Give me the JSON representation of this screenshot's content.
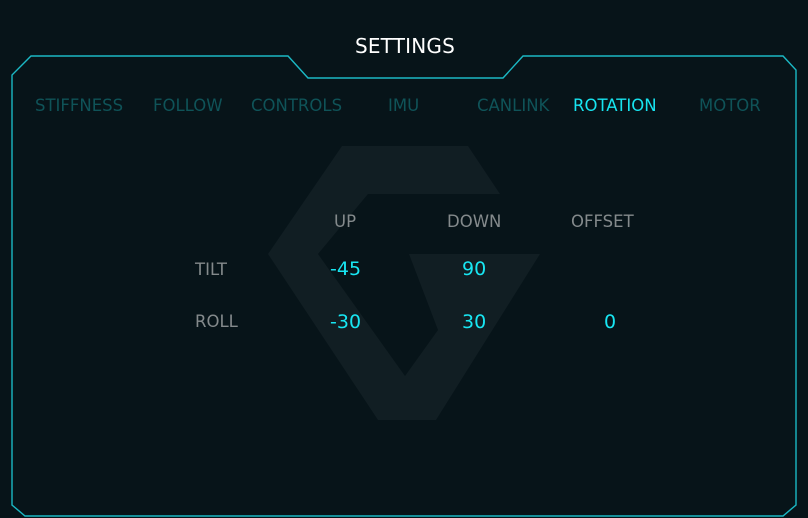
{
  "header": {
    "title": "SETTINGS"
  },
  "tabs": [
    {
      "label": "STIFFNESS",
      "active": false
    },
    {
      "label": "FOLLOW",
      "active": false
    },
    {
      "label": "CONTROLS",
      "active": false
    },
    {
      "label": "IMU",
      "active": false
    },
    {
      "label": "CANLINK",
      "active": false
    },
    {
      "label": "ROTATION",
      "active": true
    },
    {
      "label": "MOTOR",
      "active": false
    }
  ],
  "rotation_table": {
    "columns": [
      "UP",
      "DOWN",
      "OFFSET"
    ],
    "rows": [
      {
        "label": "TILT",
        "up": "-45",
        "down": "90",
        "offset": ""
      },
      {
        "label": "ROLL",
        "up": "-30",
        "down": "30",
        "offset": "0"
      }
    ]
  },
  "background": {
    "watermark_icon": "brand-logo-icon"
  },
  "colors": {
    "accent": "#17e4f0",
    "inactive_tab": "#0f5358",
    "label_gray": "#848a8c",
    "background": "#071419",
    "border": "#1bb8c4"
  }
}
